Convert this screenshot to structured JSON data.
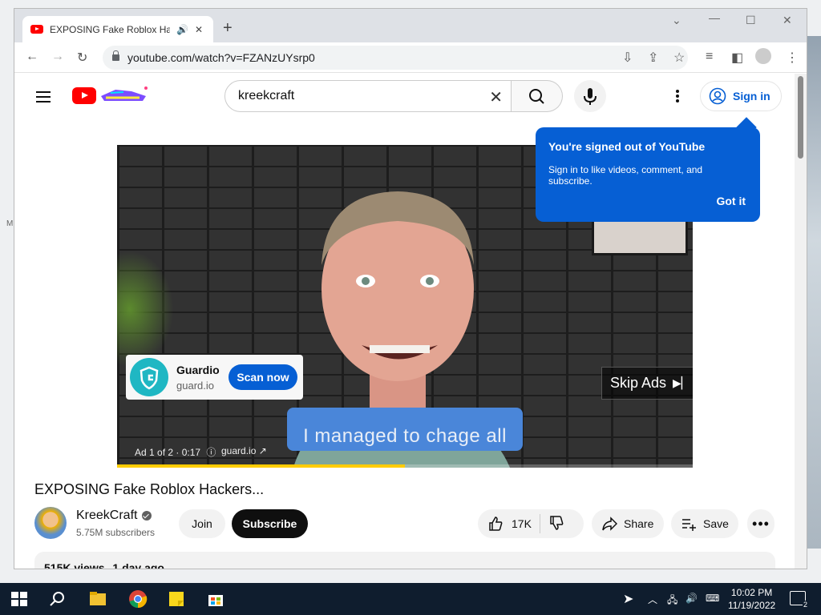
{
  "browser": {
    "tab_title": "EXPOSING Fake Roblox Hack",
    "url": "youtube.com/watch?v=FZANzUYsrp0"
  },
  "masthead": {
    "search_query": "kreekcraft",
    "signin_label": "Sign in"
  },
  "tooltip": {
    "title": "You're signed out of YouTube",
    "body": "Sign in to like videos, comment, and subscribe.",
    "button": "Got it"
  },
  "ad": {
    "advertiser": "Guardio",
    "domain": "guard.io",
    "cta": "Scan now",
    "skip_label": "Skip Ads",
    "caption": "I managed to chage all",
    "ad_counter": "Ad 1 of 2 · 0:17",
    "ad_link": "guard.io",
    "progress": 0.5
  },
  "video": {
    "title": "EXPOSING Fake Roblox Hackers...",
    "channel": "KreekCraft",
    "subscribers": "5.75M subscribers",
    "join_label": "Join",
    "subscribe_label": "Subscribe",
    "likes": "17K",
    "share_label": "Share",
    "save_label": "Save",
    "views": "515K views",
    "published": "1 day ago"
  },
  "taskbar": {
    "time": "10:02 PM",
    "date": "11/19/2022",
    "notifications": "2"
  },
  "desktop": {
    "edge_letter": "M"
  },
  "colors": {
    "youtube_red": "#ff0000",
    "youtube_blue": "#065fd4",
    "ad_progress": "#ffcc00"
  }
}
